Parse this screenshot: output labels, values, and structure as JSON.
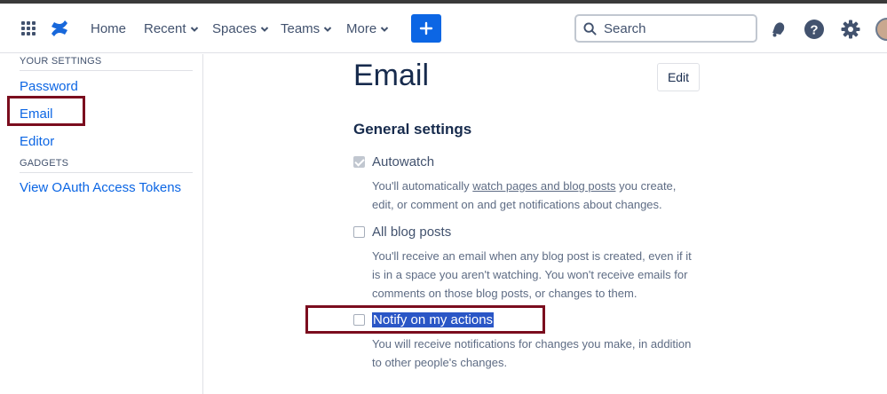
{
  "nav": {
    "items": [
      {
        "label": "Home",
        "dropdown": false
      },
      {
        "label": "Recent",
        "dropdown": true
      },
      {
        "label": "Spaces",
        "dropdown": true
      },
      {
        "label": "Teams",
        "dropdown": true
      },
      {
        "label": "More",
        "dropdown": true
      }
    ],
    "create_icon": "plus-icon",
    "search_placeholder": "Search",
    "icons": [
      "notifications-icon",
      "help-icon",
      "settings-icon",
      "avatar"
    ],
    "accent": "#0c66e4"
  },
  "sidebar": {
    "your_settings_heading": "YOUR SETTINGS",
    "password_label": "Password",
    "email_label": "Email",
    "editor_label": "Editor",
    "gadgets_heading": "GADGETS",
    "oauth_label": "View OAuth Access Tokens"
  },
  "main": {
    "title": "Email",
    "edit_label": "Edit",
    "section_title": "General settings",
    "autowatch": {
      "label": "Autowatch",
      "checked": true,
      "desc_before": "You'll automatically ",
      "desc_link": "watch pages and blog posts",
      "desc_after": " you create, edit, or comment on and get notifications about changes."
    },
    "blog_posts": {
      "label": "All blog posts",
      "checked": false,
      "desc": "You'll receive an email when any blog post is created, even if it is in a space you aren't watching. You won't receive emails for comments on those blog posts, or changes to them."
    },
    "notify": {
      "label": "Notify on my actions",
      "checked": false,
      "desc": "You will receive notifications for changes you make, in addition to other people's changes."
    }
  },
  "highlight_color": "#7b0d1e"
}
